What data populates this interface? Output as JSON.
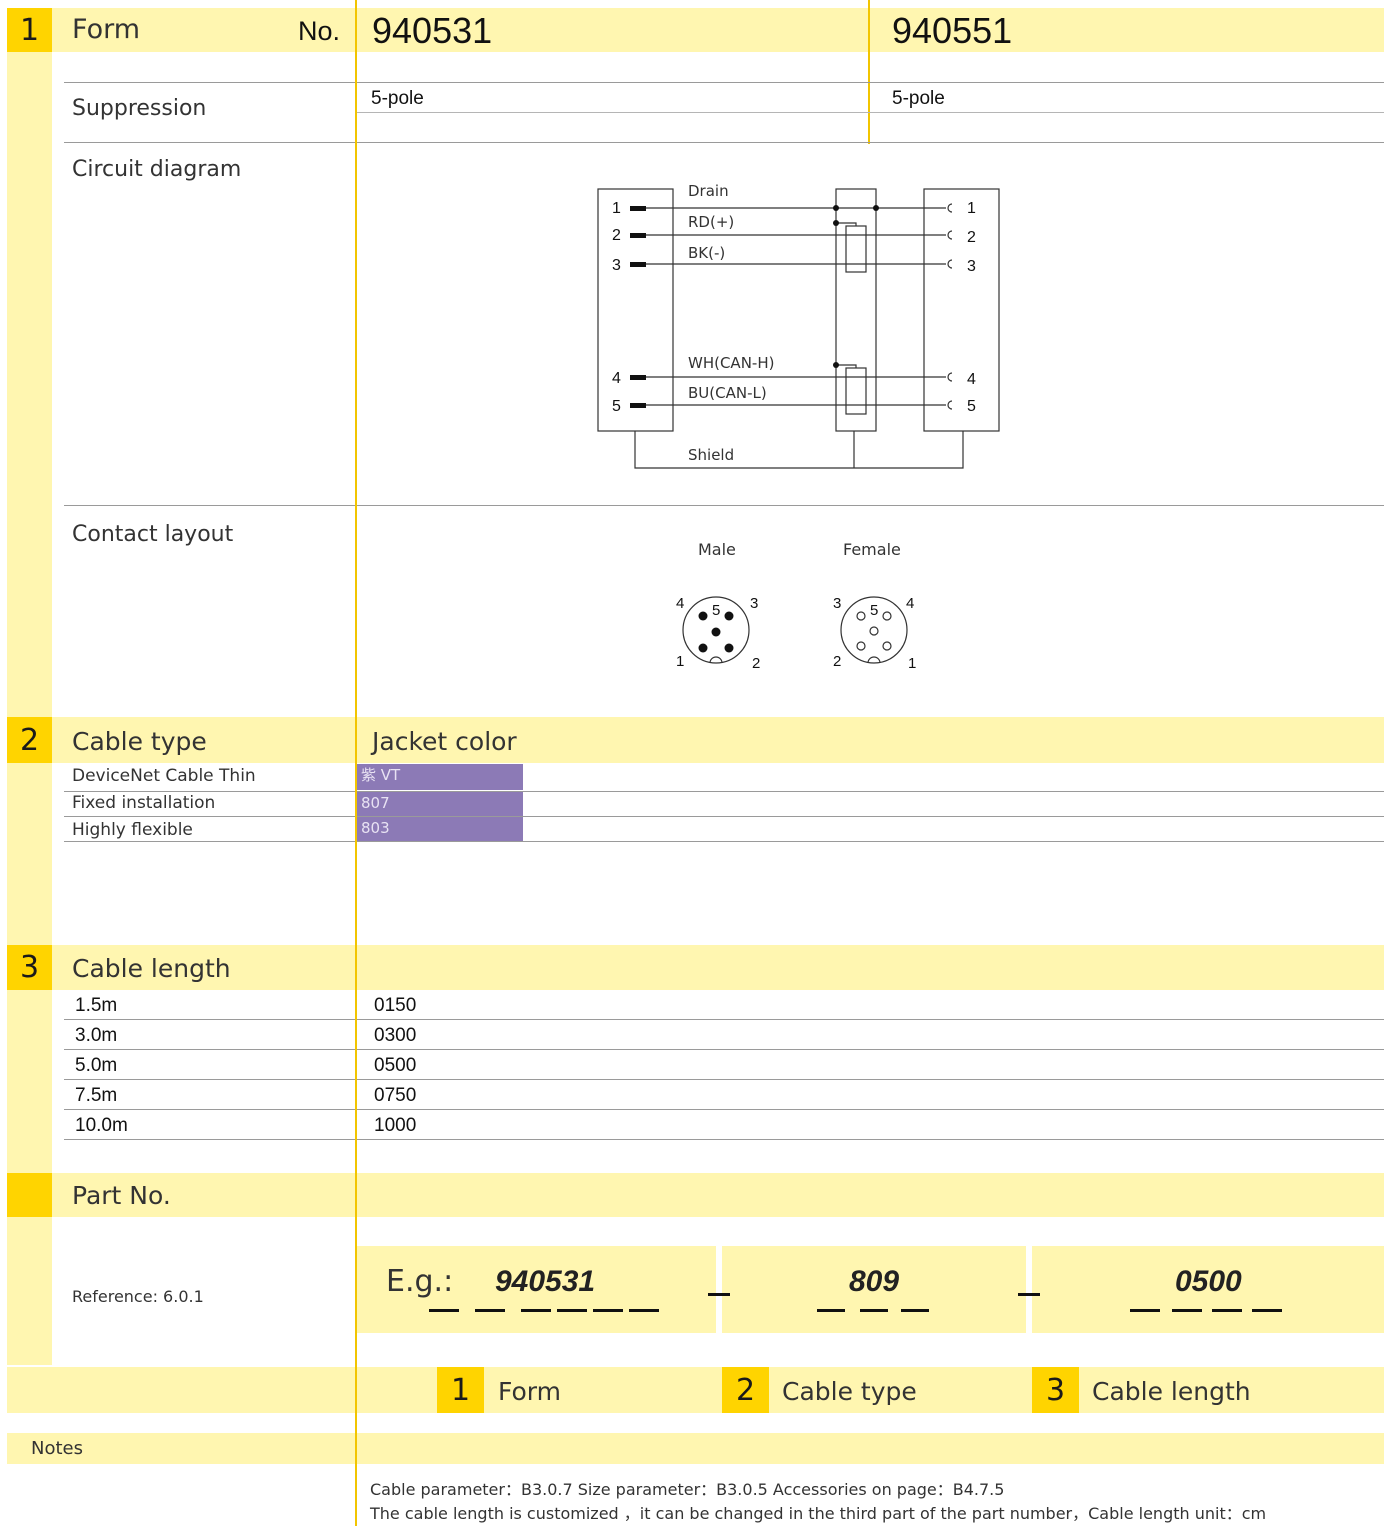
{
  "section1": {
    "number": "1",
    "title": "Form",
    "no_label": "No.",
    "part_a": "940531",
    "part_b": "940551",
    "suppression_label": "Suppression",
    "suppression_a": "5-pole",
    "suppression_b": "5-pole",
    "circuit_label": "Circuit diagram",
    "circuit": {
      "wires": [
        "Drain",
        "RD(+)",
        "BK(-)",
        "WH(CAN-H)",
        "BU(CAN-L)"
      ],
      "shield": "Shield",
      "left_pins": [
        "1",
        "2",
        "3",
        "4",
        "5"
      ],
      "right_pins": [
        "1",
        "2",
        "3",
        "4",
        "5"
      ]
    },
    "contact_label": "Contact layout",
    "male_label": "Male",
    "female_label": "Female",
    "male_pins": [
      "4",
      "5",
      "3",
      "1",
      "2"
    ],
    "female_pins": [
      "3",
      "5",
      "4",
      "2",
      "1"
    ]
  },
  "section2": {
    "number": "2",
    "title": "Cable type",
    "jacket_header": "Jacket color",
    "rows": [
      {
        "label": "DeviceNet  Cable Thin",
        "value": "紫 VT"
      },
      {
        "label": "Fixed installation",
        "value": "807"
      },
      {
        "label": "Highly flexible",
        "value": "803"
      }
    ],
    "swatch_color": "#8c7ab6"
  },
  "section3": {
    "number": "3",
    "title": "Cable length",
    "rows": [
      {
        "length": "1.5m",
        "code": "0150"
      },
      {
        "length": "3.0m",
        "code": "0300"
      },
      {
        "length": "5.0m",
        "code": "0500"
      },
      {
        "length": "7.5m",
        "code": "0750"
      },
      {
        "length": "10.0m",
        "code": "1000"
      }
    ]
  },
  "part_no": {
    "title": "Part No.",
    "reference": "Reference: 6.0.1",
    "example_label": "E.g.:",
    "part1": "940531",
    "part2": "809",
    "part3": "0500",
    "legend": [
      {
        "number": "1",
        "label": "Form"
      },
      {
        "number": "2",
        "label": "Cable type"
      },
      {
        "number": "3",
        "label": "Cable length"
      }
    ]
  },
  "notes": {
    "title": "Notes",
    "line1": "Cable parameter：B3.0.7    Size parameter：B3.0.5    Accessories on page：B4.7.5",
    "line2": "The cable length is customized ，it can be changed in the third part of the part number，Cable length unit：cm"
  },
  "colors": {
    "accent_yellow": "#ffd400",
    "band_yellow": "#fff6b0",
    "gold_line": "#f2c500",
    "purple": "#8c7ab6"
  }
}
